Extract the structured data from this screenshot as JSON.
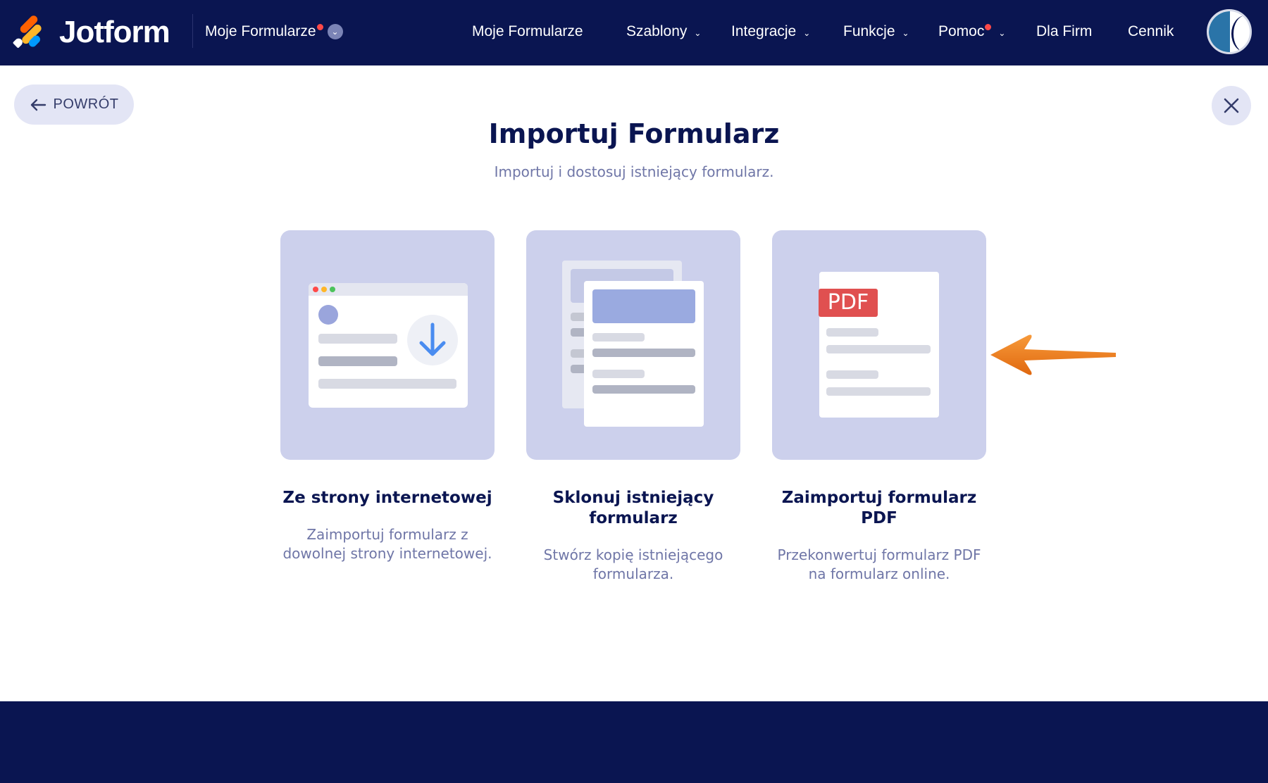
{
  "header": {
    "brand": "Jotform",
    "workspace_label": "Moje Formularze",
    "nav": [
      {
        "label": "Moje Formularze",
        "has_dropdown": false,
        "has_badge": false
      },
      {
        "label": "Szablony",
        "has_dropdown": true,
        "has_badge": false
      },
      {
        "label": "Integracje",
        "has_dropdown": true,
        "has_badge": false
      },
      {
        "label": "Funkcje",
        "has_dropdown": true,
        "has_badge": false
      },
      {
        "label": "Pomoc",
        "has_dropdown": true,
        "has_badge": true
      },
      {
        "label": "Dla Firm",
        "has_dropdown": false,
        "has_badge": false
      },
      {
        "label": "Cennik",
        "has_dropdown": false,
        "has_badge": false
      }
    ]
  },
  "back_button": {
    "label": "POWRÓT",
    "icon": "arrow-left-icon"
  },
  "close_button": {
    "icon": "close-icon"
  },
  "page": {
    "title": "Importuj Formularz",
    "subtitle": "Importuj i dostosuj istniejący formularz."
  },
  "options": [
    {
      "title": "Ze strony internetowej",
      "description": "Zaimportuj formularz z dowolnej strony internetowej.",
      "illustration": "web-import-illustration"
    },
    {
      "title": "Sklonuj istniejący formularz",
      "description": "Stwórz kopię istniejącego formularza.",
      "illustration": "clone-form-illustration"
    },
    {
      "title": "Zaimportuj formularz PDF",
      "description": "Przekonwertuj formularz PDF na formularz online.",
      "illustration": "pdf-import-illustration",
      "badge": "PDF"
    }
  ],
  "colors": {
    "navy": "#0a1551",
    "card_bg": "#ccd0ec",
    "accent_blue": "#4a8cf0",
    "pdf_red": "#e05050",
    "annotation_arrow": "#f07a1a",
    "badge_red": "#ff4948"
  }
}
